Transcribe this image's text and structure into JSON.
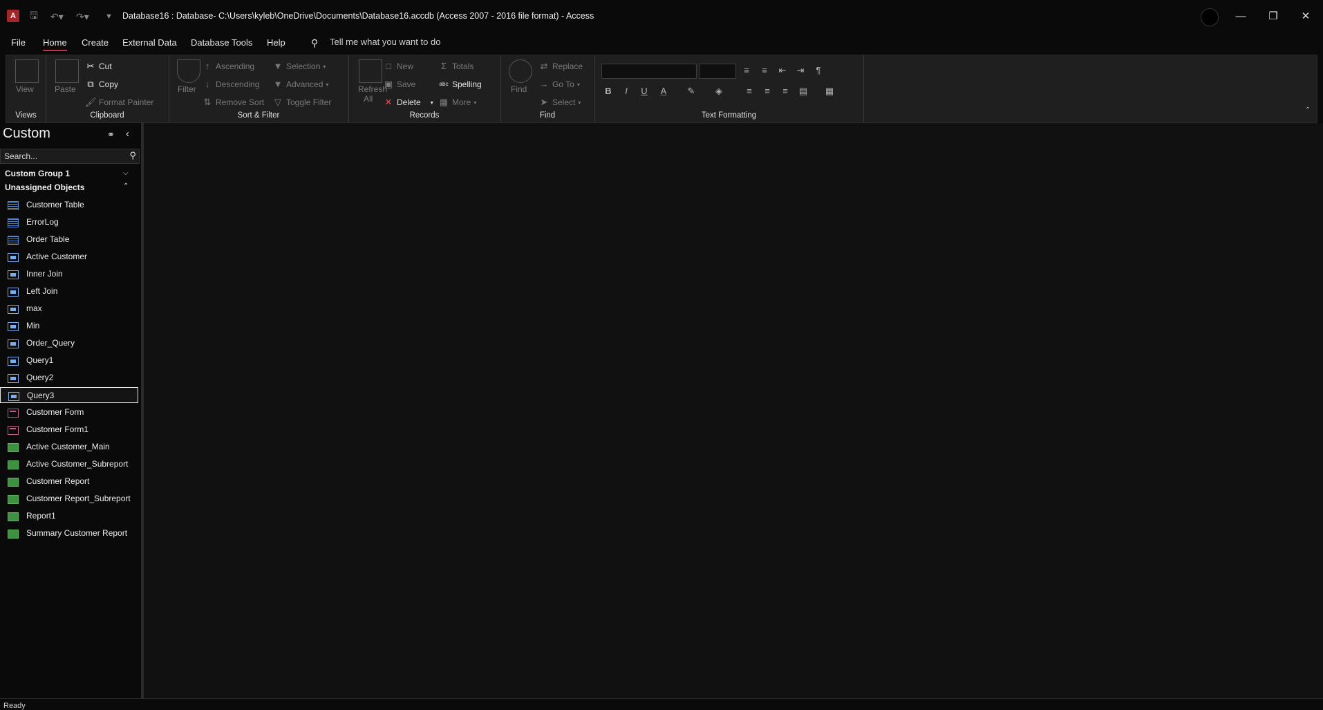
{
  "titlebar": {
    "app_letter": "A",
    "title": "Database16 : Database- C:\\Users\\kyleb\\OneDrive\\Documents\\Database16.accdb (Access 2007 - 2016 file format)  -  Access",
    "minimize": "—",
    "restore": "❐",
    "close": "✕"
  },
  "menu": {
    "file": "File",
    "home": "Home",
    "create": "Create",
    "external": "External Data",
    "dbtools": "Database Tools",
    "help": "Help",
    "tellme": "Tell me what you want to do"
  },
  "ribbon": {
    "views": {
      "label": "Views",
      "view": "View"
    },
    "clipboard": {
      "label": "Clipboard",
      "paste": "Paste",
      "cut": "Cut",
      "copy": "Copy",
      "format_painter": "Format Painter"
    },
    "sort": {
      "label": "Sort & Filter",
      "filter": "Filter",
      "ascending": "Ascending",
      "descending": "Descending",
      "remove_sort": "Remove Sort",
      "selection": "Selection",
      "advanced": "Advanced",
      "toggle_filter": "Toggle Filter"
    },
    "records": {
      "label": "Records",
      "refresh": "Refresh",
      "all": "All",
      "new": "New",
      "save": "Save",
      "delete": "Delete",
      "totals": "Totals",
      "spelling": "Spelling",
      "more": "More"
    },
    "find": {
      "label": "Find",
      "find": "Find",
      "replace": "Replace",
      "goto": "Go To",
      "select": "Select"
    },
    "text_formatting": {
      "label": "Text Formatting"
    }
  },
  "nav": {
    "title": "Custom",
    "search_placeholder": "Search...",
    "group1": "Custom Group 1",
    "group2": "Unassigned Objects",
    "objects": [
      {
        "label": "Customer Table",
        "type": "table"
      },
      {
        "label": "ErrorLog",
        "type": "table"
      },
      {
        "label": "Order Table",
        "type": "table"
      },
      {
        "label": "Active Customer",
        "type": "query"
      },
      {
        "label": "Inner Join",
        "type": "query"
      },
      {
        "label": "Left Join",
        "type": "query"
      },
      {
        "label": "max",
        "type": "query"
      },
      {
        "label": "Min",
        "type": "query"
      },
      {
        "label": "Order_Query",
        "type": "query"
      },
      {
        "label": "Query1",
        "type": "query"
      },
      {
        "label": "Query2",
        "type": "query"
      },
      {
        "label": "Query3",
        "type": "query",
        "selected": true
      },
      {
        "label": "Customer Form",
        "type": "form"
      },
      {
        "label": "Customer Form1",
        "type": "form"
      },
      {
        "label": "Active Customer_Main",
        "type": "report"
      },
      {
        "label": "Active Customer_Subreport",
        "type": "report"
      },
      {
        "label": "Customer Report",
        "type": "report"
      },
      {
        "label": "Customer Report_Subreport",
        "type": "report"
      },
      {
        "label": "Report1",
        "type": "report"
      },
      {
        "label": "Summary Customer Report",
        "type": "report"
      }
    ]
  },
  "status": {
    "text": "Ready"
  },
  "colors": {
    "accent": "#c4314b",
    "background": "#0a0a0a",
    "ribbon": "#1f1f1f"
  }
}
